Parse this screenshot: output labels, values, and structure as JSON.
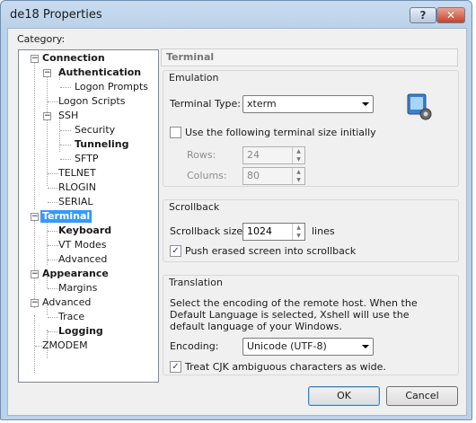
{
  "window": {
    "title": "de18 Properties",
    "help_label": "?",
    "close_label": "✕"
  },
  "category_label": "Category:",
  "tree": [
    {
      "label": "Connection",
      "bold": true,
      "expander": "−"
    },
    {
      "label": "Authentication",
      "bold": true,
      "expander": "−"
    },
    {
      "label": "Logon Prompts",
      "bold": false
    },
    {
      "label": "Logon Scripts",
      "bold": false
    },
    {
      "label": "SSH",
      "bold": false,
      "expander": "−"
    },
    {
      "label": "Security",
      "bold": false
    },
    {
      "label": "Tunneling",
      "bold": true
    },
    {
      "label": "SFTP",
      "bold": false
    },
    {
      "label": "TELNET",
      "bold": false
    },
    {
      "label": "RLOGIN",
      "bold": false
    },
    {
      "label": "SERIAL",
      "bold": false
    },
    {
      "label": "Terminal",
      "bold": true,
      "expander": "−",
      "selected": true
    },
    {
      "label": "Keyboard",
      "bold": true
    },
    {
      "label": "VT Modes",
      "bold": false
    },
    {
      "label": "Advanced",
      "bold": false
    },
    {
      "label": "Appearance",
      "bold": true,
      "expander": "−"
    },
    {
      "label": "Margins",
      "bold": false
    },
    {
      "label": "Advanced",
      "bold": false,
      "expander": "−"
    },
    {
      "label": "Trace",
      "bold": false
    },
    {
      "label": "Logging",
      "bold": true
    },
    {
      "label": "ZMODEM",
      "bold": false
    }
  ],
  "panel_title": "Terminal",
  "emulation": {
    "title": "Emulation",
    "terminal_type_label": "Terminal Type:",
    "terminal_type_value": "xterm",
    "use_size_label": "Use the following terminal size initially",
    "use_size_checked": "",
    "rows_label": "Rows:",
    "rows_value": "24",
    "columns_label": "Colums:",
    "columns_value": "80"
  },
  "scrollback": {
    "title": "Scrollback",
    "size_label": "Scrollback size:",
    "size_value": "1024",
    "size_unit": "lines",
    "push_label": "Push erased screen into scrollback",
    "push_checked": "✓"
  },
  "translation": {
    "title": "Translation",
    "description": "Select the encoding of the remote host. When the Default Language is selected, Xshell will use the default language of your Windows.",
    "encoding_label": "Encoding:",
    "encoding_value": "Unicode (UTF-8)",
    "cjk_label": "Treat CJK ambiguous characters as wide.",
    "cjk_checked": "✓"
  },
  "buttons": {
    "ok": "OK",
    "cancel": "Cancel"
  },
  "colors": {
    "selection": "#3399ff",
    "title_bar": "#bcd2ea"
  }
}
